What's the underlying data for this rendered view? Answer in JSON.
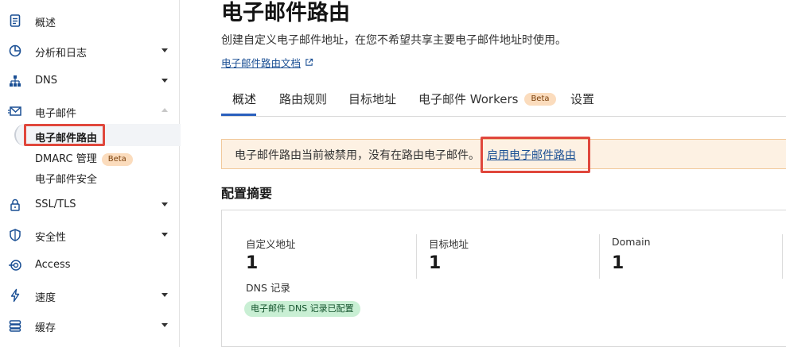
{
  "sidebar": {
    "items": [
      {
        "label": "概述",
        "icon": "document-icon"
      },
      {
        "label": "分析和日志",
        "icon": "pie-chart-icon"
      },
      {
        "label": "DNS",
        "icon": "network-tree-icon"
      },
      {
        "label": "电子邮件",
        "icon": "mail-icon"
      },
      {
        "label": "SSL/TLS",
        "icon": "lock-icon"
      },
      {
        "label": "安全性",
        "icon": "shield-icon"
      },
      {
        "label": "Access",
        "icon": "access-icon"
      },
      {
        "label": "速度",
        "icon": "lightning-icon"
      },
      {
        "label": "缓存",
        "icon": "database-icon"
      }
    ],
    "email_sub_items": [
      {
        "label": "电子邮件路由"
      },
      {
        "label": "DMARC 管理",
        "badge": "Beta"
      },
      {
        "label": "电子邮件安全"
      }
    ]
  },
  "main": {
    "title": "电子邮件路由",
    "subtitle": "创建自定义电子邮件地址，在您不希望共享主要电子邮件地址时使用。",
    "doc_link": "电子邮件路由文档",
    "tabs": [
      {
        "label": "概述"
      },
      {
        "label": "路由规则"
      },
      {
        "label": "目标地址"
      },
      {
        "label": "电子邮件 Workers",
        "badge": "Beta"
      },
      {
        "label": "设置"
      }
    ],
    "banner": {
      "text": "电子邮件路由当前被禁用，没有在路由电子邮件。",
      "link": "启用电子邮件路由"
    },
    "summary": {
      "title": "配置摘要",
      "stats": [
        {
          "label": "自定义地址",
          "value": "1"
        },
        {
          "label": "目标地址",
          "value": "1"
        },
        {
          "label": "Domain",
          "value": "1"
        }
      ],
      "dns_label": "DNS 记录",
      "dns_badge": "电子邮件 DNS 记录已配置"
    }
  },
  "colors": {
    "accent": "#2a5fbd",
    "link": "#1a4f94",
    "highlight": "#e0473c",
    "banner_bg": "#fdf1e3",
    "beta_bg": "#fbdcbd",
    "success_bg": "#c9efd4"
  }
}
